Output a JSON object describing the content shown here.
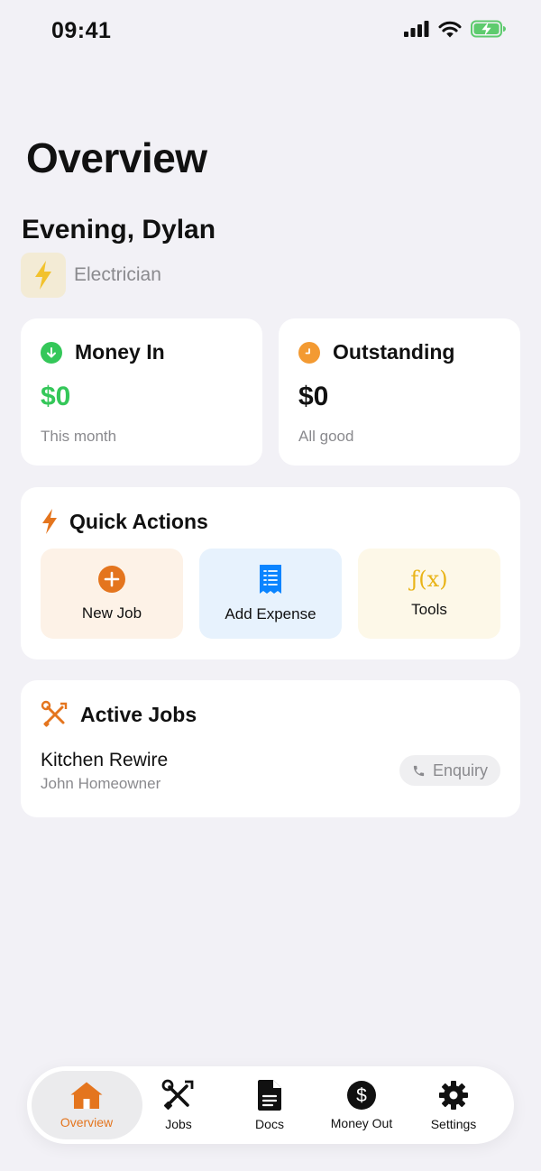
{
  "status_bar": {
    "time": "09:41"
  },
  "page": {
    "title": "Overview"
  },
  "user": {
    "greeting": "Evening, Dylan",
    "trade": "Electrician"
  },
  "stats": {
    "money_in": {
      "title": "Money In",
      "value": "$0",
      "subtitle": "This month"
    },
    "outstanding": {
      "title": "Outstanding",
      "value": "$0",
      "subtitle": "All good"
    }
  },
  "quick_actions": {
    "title": "Quick Actions",
    "items": [
      {
        "label": "New Job",
        "icon": "plus-circle-icon"
      },
      {
        "label": "Add Expense",
        "icon": "receipt-icon"
      },
      {
        "label": "Tools",
        "icon": "function-icon",
        "glyph": "ƒ(x)"
      }
    ]
  },
  "active_jobs": {
    "title": "Active Jobs",
    "jobs": [
      {
        "name": "Kitchen Rewire",
        "client": "John Homeowner",
        "status": "Enquiry"
      }
    ]
  },
  "tab_bar": {
    "tabs": [
      {
        "label": "Overview",
        "icon": "house-icon",
        "active": true
      },
      {
        "label": "Jobs",
        "icon": "wrench-screwdriver-icon"
      },
      {
        "label": "Docs",
        "icon": "document-icon"
      },
      {
        "label": "Money Out",
        "icon": "dollar-circle-icon"
      },
      {
        "label": "Settings",
        "icon": "gear-icon"
      }
    ]
  },
  "colors": {
    "accent": "#E4751E",
    "green": "#34C759",
    "orange": "#F39A32",
    "blue": "#0A84FF",
    "yellow": "#F2C22D",
    "background": "#F2F1F6"
  }
}
